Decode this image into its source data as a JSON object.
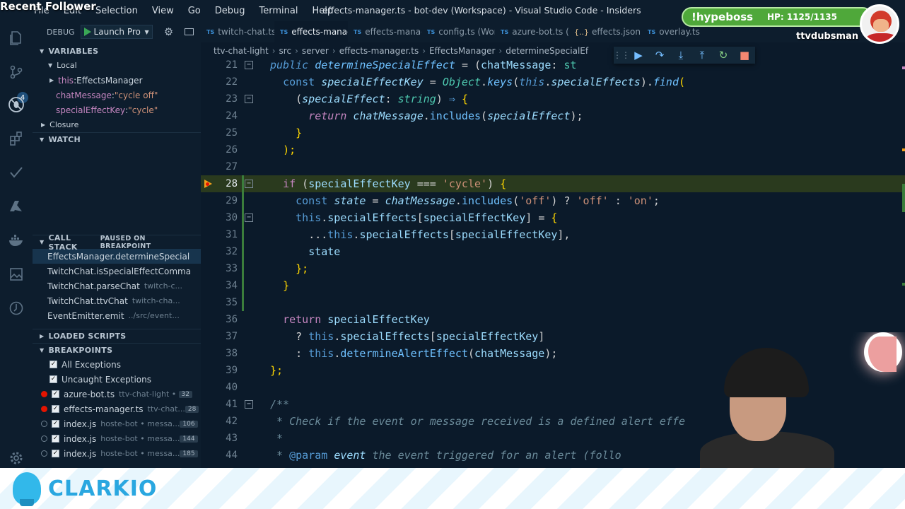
{
  "window": {
    "menu": [
      "File",
      "Edit",
      "Selection",
      "View",
      "Go",
      "Debug",
      "Terminal",
      "Help"
    ],
    "title": "effects-manager.ts - bot-dev (Workspace) - Visual Studio Code - Insiders"
  },
  "overlay": {
    "recent_follower": "Recent Follower",
    "hype_name": "!hypeboss",
    "hype_hp": "HP: 1125/1135",
    "hype_user": "ttvdubsman",
    "brand": "CLARKIO"
  },
  "activity": {
    "badge": "4"
  },
  "debug": {
    "label": "DEBUG",
    "launch": "Launch Pro"
  },
  "variables": {
    "header": "VARIABLES",
    "local": "Local",
    "rows": [
      {
        "name": "this",
        "value": "EffectsManager"
      },
      {
        "name": "chatMessage",
        "value": "\"cycle off\""
      },
      {
        "name": "specialEffectKey",
        "value": "\"cycle\""
      }
    ],
    "closure": "Closure"
  },
  "watch": {
    "header": "WATCH"
  },
  "callstack": {
    "header": "CALL STACK",
    "status": "PAUSED ON BREAKPOINT",
    "frames": [
      {
        "name": "EffectsManager.determineSpecial",
        "file": ""
      },
      {
        "name": "TwitchChat.isSpecialEffectComma",
        "file": ""
      },
      {
        "name": "TwitchChat.parseChat",
        "file": "twitch-c..."
      },
      {
        "name": "TwitchChat.ttvChat",
        "file": "twitch-cha..."
      },
      {
        "name": "EventEmitter.emit",
        "file": "../src/event..."
      }
    ]
  },
  "loaded_scripts": {
    "header": "LOADED SCRIPTS"
  },
  "breakpoints": {
    "header": "BREAKPOINTS",
    "rows": [
      {
        "label": "All Exceptions",
        "file": "",
        "count": "",
        "dot": false
      },
      {
        "label": "Uncaught Exceptions",
        "file": "",
        "count": "",
        "dot": false
      },
      {
        "label": "azure-bot.ts",
        "file": "ttv-chat-light •",
        "count": "32",
        "dot": true
      },
      {
        "label": "effects-manager.ts",
        "file": "ttv-chat...",
        "count": "28",
        "dot": true
      },
      {
        "label": "index.js",
        "file": "hoste-bot • messa...",
        "count": "106",
        "dot": false
      },
      {
        "label": "index.js",
        "file": "hoste-bot • messa...",
        "count": "144",
        "dot": false
      },
      {
        "label": "index.js",
        "file": "hoste-bot • messa...",
        "count": "185",
        "dot": false
      }
    ]
  },
  "tabs": [
    {
      "label": "twitch-chat.ts",
      "kind": "TS",
      "active": false
    },
    {
      "label": "effects-manag",
      "kind": "TS",
      "active": true
    },
    {
      "label": "effects-manag",
      "kind": "TS",
      "active": false
    },
    {
      "label": "config.ts (Wor",
      "kind": "TS",
      "active": false
    },
    {
      "label": "azure-bot.ts (\\",
      "kind": "TS",
      "active": false
    },
    {
      "label": "effects.json",
      "kind": "JSON",
      "active": false
    },
    {
      "label": "overlay.ts",
      "kind": "TS",
      "active": false
    }
  ],
  "breadcrumbs": [
    "ttv-chat-light",
    "src",
    "server",
    "effects-manager.ts",
    "EffectsManager",
    "determineSpecialEf"
  ],
  "editor": {
    "current_line": "28",
    "lines": [
      {
        "n": "21",
        "fold": true,
        "html": "<span class='kw it'>public</span> <span class='fn it'>determineSpecialEffect</span> <span class='op'>=</span> <span class='op'>(</span><span class='prop'>chatMessage</span><span class='op'>:</span> <span class='ty'>st</span>"
      },
      {
        "n": "22",
        "fold": false,
        "html": "  <span class='kw'>const</span> <span class='prop it'>specialEffectKey</span> <span class='op'>=</span> <span class='ty it'>Object</span><span class='op'>.</span><span class='fn it'>keys</span><span class='op'>(</span><span class='kw it'>this</span><span class='op'>.</span><span class='prop it'>specialEffects</span><span class='op'>).</span><span class='fn it'>find</span><span class='pu'>(</span>"
      },
      {
        "n": "23",
        "fold": true,
        "html": "    <span class='op'>(</span><span class='prop it'>specialEffect</span><span class='op'>:</span> <span class='ty it'>string</span><span class='op'>)</span> <span class='kw'>⇒</span> <span class='pu'>{</span>"
      },
      {
        "n": "24",
        "fold": false,
        "html": "      <span class='k it'>return</span> <span class='prop it'>chatMessage</span><span class='op'>.</span><span class='fn'>includes</span><span class='op'>(</span><span class='prop it'>specialEffect</span><span class='op'>);</span>"
      },
      {
        "n": "25",
        "fold": false,
        "html": "    <span class='pu'>}</span>"
      },
      {
        "n": "26",
        "fold": false,
        "html": "  <span class='pu'>);</span>"
      },
      {
        "n": "27",
        "fold": false,
        "html": ""
      },
      {
        "n": "28",
        "fold": true,
        "html": "  <span class='k'>if</span> <span class='op'>(</span><span class='prop'>specialEffectKey</span> <span class='op'>===</span> <span class='str'>'cycle'</span><span class='op'>)</span> <span class='pu'>{</span>"
      },
      {
        "n": "29",
        "fold": false,
        "html": "    <span class='kw'>const</span> <span class='prop it'>state</span> <span class='op'>=</span> <span class='prop it'>chatMessage</span><span class='op'>.</span><span class='fn'>includes</span><span class='op'>(</span><span class='str'>'off'</span><span class='op'>)</span> <span class='op'>?</span> <span class='str'>'off'</span> <span class='op'>:</span> <span class='str'>'on'</span><span class='op'>;</span>"
      },
      {
        "n": "30",
        "fold": true,
        "html": "    <span class='kw'>this</span><span class='op'>.</span><span class='prop'>specialEffects</span><span class='op'>[</span><span class='prop'>specialEffectKey</span><span class='op'>]</span> <span class='op'>=</span> <span class='pu'>{</span>"
      },
      {
        "n": "31",
        "fold": false,
        "html": "      <span class='op'>...</span><span class='kw'>this</span><span class='op'>.</span><span class='prop'>specialEffects</span><span class='op'>[</span><span class='prop'>specialEffectKey</span><span class='op'>],</span>"
      },
      {
        "n": "32",
        "fold": false,
        "html": "      <span class='prop'>state</span>"
      },
      {
        "n": "33",
        "fold": false,
        "html": "    <span class='pu'>};</span>"
      },
      {
        "n": "34",
        "fold": false,
        "html": "  <span class='pu'>}</span>"
      },
      {
        "n": "35",
        "fold": false,
        "html": ""
      },
      {
        "n": "36",
        "fold": false,
        "html": "  <span class='k'>return</span> <span class='prop'>specialEffectKey</span>"
      },
      {
        "n": "37",
        "fold": false,
        "html": "    <span class='op'>?</span> <span class='kw'>this</span><span class='op'>.</span><span class='prop'>specialEffects</span><span class='op'>[</span><span class='prop'>specialEffectKey</span><span class='op'>]</span>"
      },
      {
        "n": "38",
        "fold": false,
        "html": "    <span class='op'>:</span> <span class='kw'>this</span><span class='op'>.</span><span class='fn'>determineAlertEffect</span><span class='op'>(</span><span class='prop'>chatMessage</span><span class='op'>);</span>"
      },
      {
        "n": "39",
        "fold": false,
        "html": "<span class='pu'>};</span>"
      },
      {
        "n": "40",
        "fold": false,
        "html": ""
      },
      {
        "n": "41",
        "fold": true,
        "html": "<span class='cm'>/**</span>"
      },
      {
        "n": "42",
        "fold": false,
        "html": "<span class='cm'> * Check if the event or message received is a defined alert effe</span>"
      },
      {
        "n": "43",
        "fold": false,
        "html": "<span class='cm'> *</span>"
      },
      {
        "n": "44",
        "fold": false,
        "html": "<span class='cm'> * </span><span class='kw'>@param</span> <span class='prop it'>event</span> <span class='cm'>the event triggered for an alert (follo</span>"
      }
    ]
  }
}
